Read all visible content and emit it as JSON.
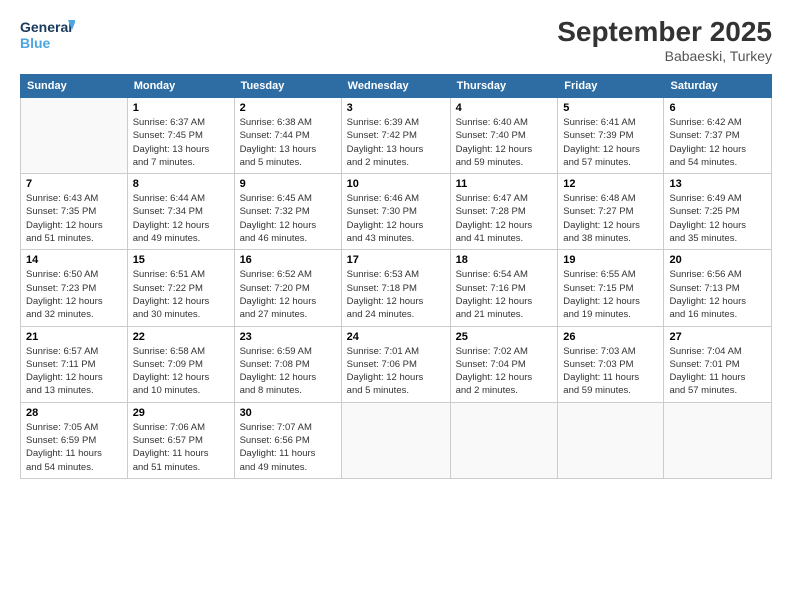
{
  "logo": {
    "line1": "General",
    "line2": "Blue"
  },
  "title": "September 2025",
  "subtitle": "Babaeski, Turkey",
  "headers": [
    "Sunday",
    "Monday",
    "Tuesday",
    "Wednesday",
    "Thursday",
    "Friday",
    "Saturday"
  ],
  "weeks": [
    [
      {
        "date": "",
        "info": ""
      },
      {
        "date": "1",
        "info": "Sunrise: 6:37 AM\nSunset: 7:45 PM\nDaylight: 13 hours\nand 7 minutes."
      },
      {
        "date": "2",
        "info": "Sunrise: 6:38 AM\nSunset: 7:44 PM\nDaylight: 13 hours\nand 5 minutes."
      },
      {
        "date": "3",
        "info": "Sunrise: 6:39 AM\nSunset: 7:42 PM\nDaylight: 13 hours\nand 2 minutes."
      },
      {
        "date": "4",
        "info": "Sunrise: 6:40 AM\nSunset: 7:40 PM\nDaylight: 12 hours\nand 59 minutes."
      },
      {
        "date": "5",
        "info": "Sunrise: 6:41 AM\nSunset: 7:39 PM\nDaylight: 12 hours\nand 57 minutes."
      },
      {
        "date": "6",
        "info": "Sunrise: 6:42 AM\nSunset: 7:37 PM\nDaylight: 12 hours\nand 54 minutes."
      }
    ],
    [
      {
        "date": "7",
        "info": "Sunrise: 6:43 AM\nSunset: 7:35 PM\nDaylight: 12 hours\nand 51 minutes."
      },
      {
        "date": "8",
        "info": "Sunrise: 6:44 AM\nSunset: 7:34 PM\nDaylight: 12 hours\nand 49 minutes."
      },
      {
        "date": "9",
        "info": "Sunrise: 6:45 AM\nSunset: 7:32 PM\nDaylight: 12 hours\nand 46 minutes."
      },
      {
        "date": "10",
        "info": "Sunrise: 6:46 AM\nSunset: 7:30 PM\nDaylight: 12 hours\nand 43 minutes."
      },
      {
        "date": "11",
        "info": "Sunrise: 6:47 AM\nSunset: 7:28 PM\nDaylight: 12 hours\nand 41 minutes."
      },
      {
        "date": "12",
        "info": "Sunrise: 6:48 AM\nSunset: 7:27 PM\nDaylight: 12 hours\nand 38 minutes."
      },
      {
        "date": "13",
        "info": "Sunrise: 6:49 AM\nSunset: 7:25 PM\nDaylight: 12 hours\nand 35 minutes."
      }
    ],
    [
      {
        "date": "14",
        "info": "Sunrise: 6:50 AM\nSunset: 7:23 PM\nDaylight: 12 hours\nand 32 minutes."
      },
      {
        "date": "15",
        "info": "Sunrise: 6:51 AM\nSunset: 7:22 PM\nDaylight: 12 hours\nand 30 minutes."
      },
      {
        "date": "16",
        "info": "Sunrise: 6:52 AM\nSunset: 7:20 PM\nDaylight: 12 hours\nand 27 minutes."
      },
      {
        "date": "17",
        "info": "Sunrise: 6:53 AM\nSunset: 7:18 PM\nDaylight: 12 hours\nand 24 minutes."
      },
      {
        "date": "18",
        "info": "Sunrise: 6:54 AM\nSunset: 7:16 PM\nDaylight: 12 hours\nand 21 minutes."
      },
      {
        "date": "19",
        "info": "Sunrise: 6:55 AM\nSunset: 7:15 PM\nDaylight: 12 hours\nand 19 minutes."
      },
      {
        "date": "20",
        "info": "Sunrise: 6:56 AM\nSunset: 7:13 PM\nDaylight: 12 hours\nand 16 minutes."
      }
    ],
    [
      {
        "date": "21",
        "info": "Sunrise: 6:57 AM\nSunset: 7:11 PM\nDaylight: 12 hours\nand 13 minutes."
      },
      {
        "date": "22",
        "info": "Sunrise: 6:58 AM\nSunset: 7:09 PM\nDaylight: 12 hours\nand 10 minutes."
      },
      {
        "date": "23",
        "info": "Sunrise: 6:59 AM\nSunset: 7:08 PM\nDaylight: 12 hours\nand 8 minutes."
      },
      {
        "date": "24",
        "info": "Sunrise: 7:01 AM\nSunset: 7:06 PM\nDaylight: 12 hours\nand 5 minutes."
      },
      {
        "date": "25",
        "info": "Sunrise: 7:02 AM\nSunset: 7:04 PM\nDaylight: 12 hours\nand 2 minutes."
      },
      {
        "date": "26",
        "info": "Sunrise: 7:03 AM\nSunset: 7:03 PM\nDaylight: 11 hours\nand 59 minutes."
      },
      {
        "date": "27",
        "info": "Sunrise: 7:04 AM\nSunset: 7:01 PM\nDaylight: 11 hours\nand 57 minutes."
      }
    ],
    [
      {
        "date": "28",
        "info": "Sunrise: 7:05 AM\nSunset: 6:59 PM\nDaylight: 11 hours\nand 54 minutes."
      },
      {
        "date": "29",
        "info": "Sunrise: 7:06 AM\nSunset: 6:57 PM\nDaylight: 11 hours\nand 51 minutes."
      },
      {
        "date": "30",
        "info": "Sunrise: 7:07 AM\nSunset: 6:56 PM\nDaylight: 11 hours\nand 49 minutes."
      },
      {
        "date": "",
        "info": ""
      },
      {
        "date": "",
        "info": ""
      },
      {
        "date": "",
        "info": ""
      },
      {
        "date": "",
        "info": ""
      }
    ]
  ]
}
